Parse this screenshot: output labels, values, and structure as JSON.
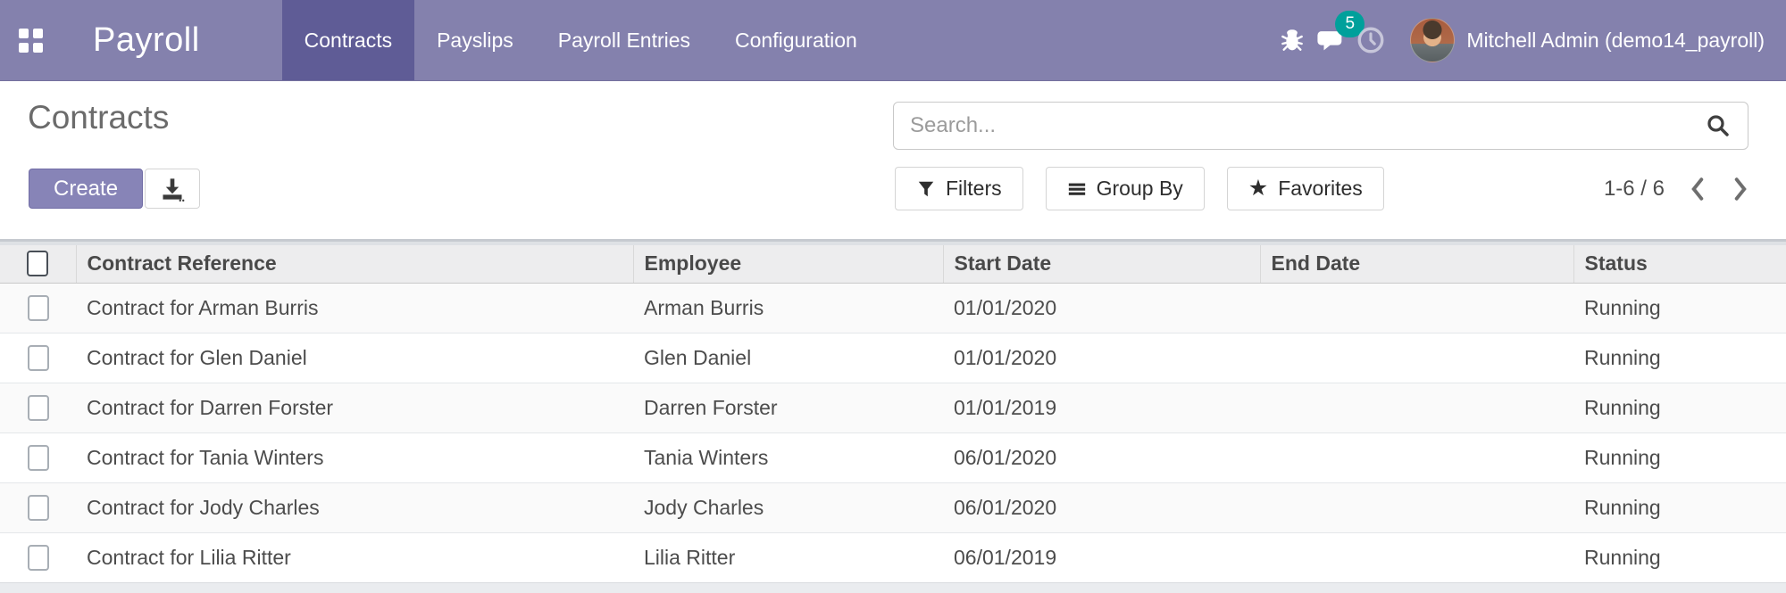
{
  "navbar": {
    "brand": "Payroll",
    "menus": [
      {
        "label": "Contracts",
        "active": true
      },
      {
        "label": "Payslips",
        "active": false
      },
      {
        "label": "Payroll Entries",
        "active": false
      },
      {
        "label": "Configuration",
        "active": false
      }
    ],
    "icons": [
      "bug-icon",
      "messages-icon",
      "activities-clock-icon"
    ],
    "message_badge": "5",
    "user": "Mitchell Admin (demo14_payroll)"
  },
  "control_panel": {
    "title": "Contracts",
    "create_label": "Create",
    "export_icon": "download-export-icon",
    "search_placeholder": "Search...",
    "filters_label": "Filters",
    "group_by_label": "Group By",
    "favorites_label": "Favorites",
    "pager": "1-6 / 6"
  },
  "table": {
    "columns": [
      "Contract Reference",
      "Employee",
      "Start Date",
      "End Date",
      "Status"
    ],
    "rows": [
      {
        "contract_reference": "Contract for Arman Burris",
        "employee": "Arman Burris",
        "start_date": "01/01/2020",
        "end_date": "",
        "status": "Running"
      },
      {
        "contract_reference": "Contract for Glen Daniel",
        "employee": "Glen Daniel",
        "start_date": "01/01/2020",
        "end_date": "",
        "status": "Running"
      },
      {
        "contract_reference": "Contract for Darren Forster",
        "employee": "Darren Forster",
        "start_date": "01/01/2019",
        "end_date": "",
        "status": "Running"
      },
      {
        "contract_reference": "Contract for Tania Winters",
        "employee": "Tania Winters",
        "start_date": "06/01/2020",
        "end_date": "",
        "status": "Running"
      },
      {
        "contract_reference": "Contract for Jody Charles",
        "employee": "Jody Charles",
        "start_date": "06/01/2020",
        "end_date": "",
        "status": "Running"
      },
      {
        "contract_reference": "Contract for Lilia Ritter",
        "employee": "Lilia Ritter",
        "start_date": "06/01/2019",
        "end_date": "",
        "status": "Running"
      }
    ]
  },
  "colors": {
    "navbar_bg": "#8481ad",
    "navbar_active_bg": "#5f5c96",
    "badge_teal": "#00a09b",
    "create_button": "#8784b7",
    "header_bg": "#ededee",
    "stripe_row": "#fafafa"
  }
}
